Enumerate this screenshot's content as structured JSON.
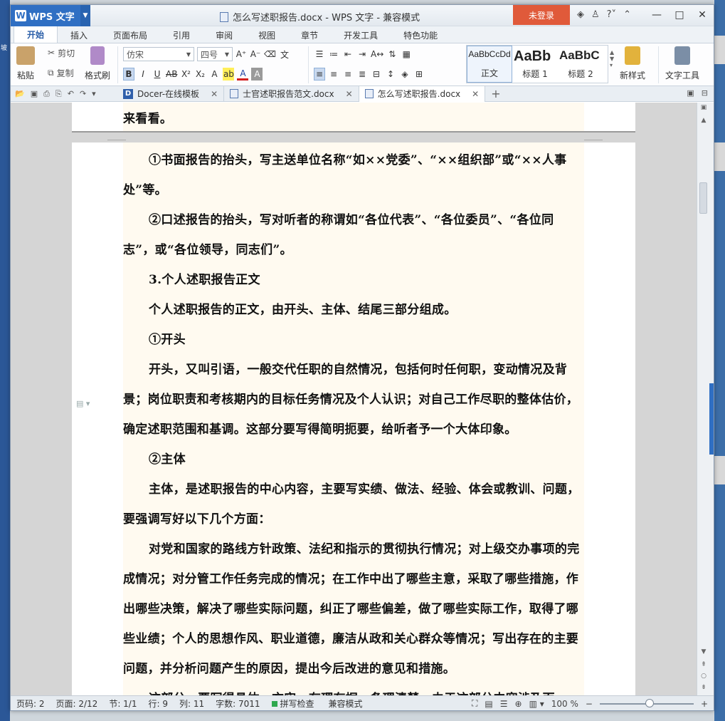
{
  "app": {
    "name": "WPS 文字",
    "window_title": "怎么写述职报告.docx - WPS 文字 - 兼容模式",
    "login": "未登录"
  },
  "ribbon_tabs": [
    "开始",
    "插入",
    "页面布局",
    "引用",
    "审阅",
    "视图",
    "章节",
    "开发工具",
    "特色功能"
  ],
  "ribbon": {
    "paste": "粘贴",
    "cut": "剪切",
    "copy": "复制",
    "format_painter": "格式刷",
    "font_name": "仿宋",
    "font_size": "四号",
    "styles": [
      {
        "preview": "AaBbCcDd",
        "name": "正文"
      },
      {
        "preview": "AaBb",
        "name": "标题 1"
      },
      {
        "preview": "AaBbC",
        "name": "标题 2"
      }
    ],
    "new_style": "新样式",
    "text_tools": "文字工具"
  },
  "doc_tabs": [
    {
      "label": "Docer-在线模板",
      "active": false
    },
    {
      "label": "士官述职报告范文.docx",
      "active": false
    },
    {
      "label": "怎么写述职报告.docx",
      "active": true
    }
  ],
  "document": {
    "prev_page_tail": "来看看。",
    "paragraphs": [
      "①书面报告的抬头，写主送单位名称“如××党委”、“××组织部”或“××人事处”等。",
      "②口述报告的抬头，写对听者的称谓如“各位代表”、“各位委员”、“各位同志”，或“各位领导，同志们”。",
      "3.个人述职报告正文",
      "个人述职报告的正文，由开头、主体、结尾三部分组成。",
      "①开头",
      "开头，又叫引语，一般交代任职的自然情况，包括何时任何职，变动情况及背景；岗位职责和考核期内的目标任务情况及个人认识；对自己工作尽职的整体估价，确定述职范围和基调。这部分要写得简明扼要，给听者予一个大体印象。",
      "②主体",
      "主体，是述职报告的中心内容，主要写实绩、做法、经验、体会或教训、问题，要强调写好以下几个方面：",
      "对党和国家的路线方针政策、法纪和指示的贯彻执行情况；对上级交办事项的完成情况；对分管工作任务完成的情况；在工作中出了哪些主意，采取了哪些措施，作出哪些决策，解决了哪些实际问题，纠正了哪些偏差，做了哪些实际工作，取得了哪些业绩；个人的思想作风、职业道德，廉洁从政和关心群众等情况；写出存在的主要问题，并分析问题产生的原因，提出今后改进的意见和措施。",
      "这部分，要写得具体、充实、有理有据、条理清楚。由于这部分内容涉及面"
    ]
  },
  "status": {
    "page": "页码: 2",
    "pages": "页面: 2/12",
    "section": "节: 1/1",
    "line": "行: 9",
    "column": "列: 11",
    "words": "字数: 7011",
    "spell": "拼写检查",
    "compat": "兼容模式",
    "zoom": "100 %"
  }
}
